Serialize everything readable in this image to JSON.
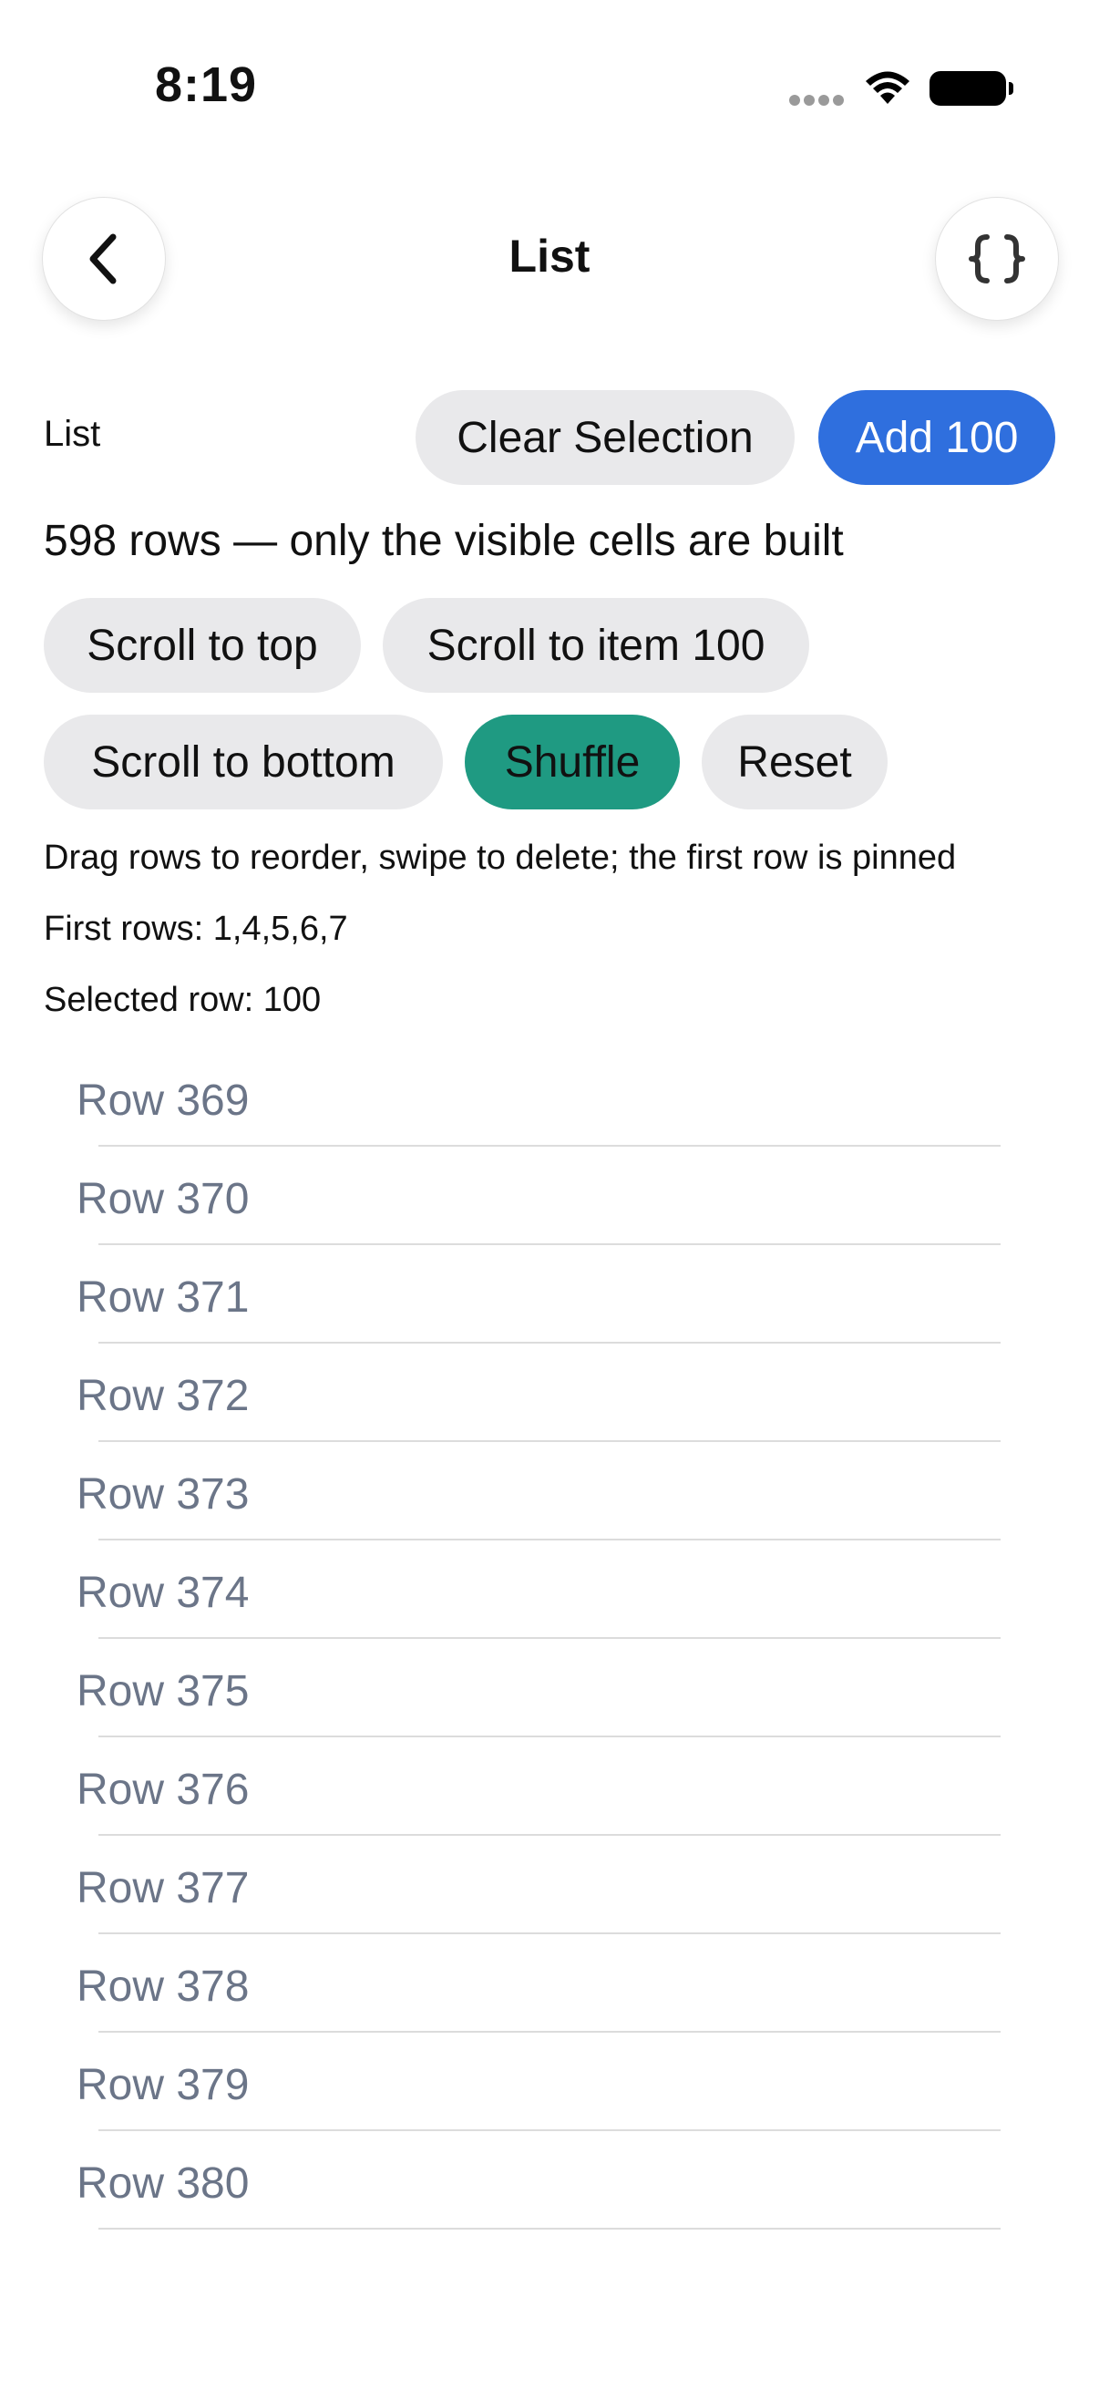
{
  "status_bar": {
    "time": "8:19"
  },
  "nav": {
    "title": "List",
    "back_icon": "chevron-left-icon",
    "code_icon": "curly-braces-icon"
  },
  "controls": {
    "section_label": "List",
    "clear_selection": "Clear Selection",
    "add_100": "Add 100",
    "rows_info": "598 rows — only the visible cells are built",
    "scroll_to_top": "Scroll to top",
    "scroll_to_item": "Scroll to item 100",
    "scroll_to_bottom": "Scroll to bottom",
    "shuffle": "Shuffle",
    "reset": "Reset",
    "hint": "Drag rows to reorder, swipe to delete; the first row is pinned",
    "first_rows": "First rows: 1,4,5,6,7",
    "selected_row": "Selected row: 100"
  },
  "colors": {
    "add_button": "#2f6fde",
    "shuffle_button": "#1f9a82",
    "pill_background": "#e9e9eb",
    "row_text": "#6b7588"
  },
  "rows": [
    "Row 369",
    "Row 370",
    "Row 371",
    "Row 372",
    "Row 373",
    "Row 374",
    "Row 375",
    "Row 376",
    "Row 377",
    "Row 378",
    "Row 379",
    "Row 380"
  ]
}
